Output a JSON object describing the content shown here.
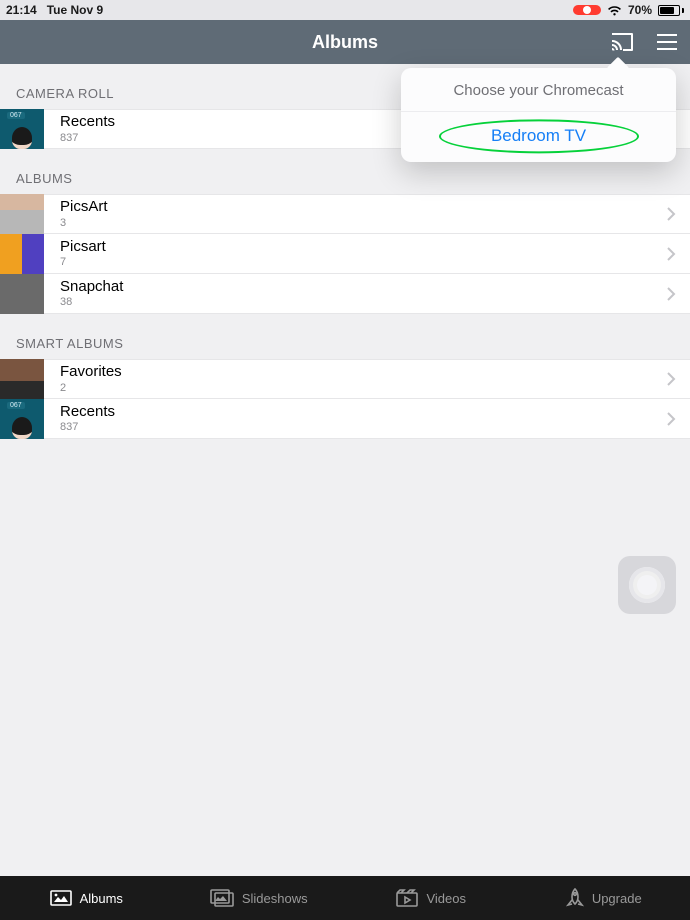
{
  "status": {
    "time": "21:14",
    "date": "Tue Nov 9",
    "battery_pct": "70%"
  },
  "header": {
    "title": "Albums"
  },
  "popover": {
    "title": "Choose your Chromecast",
    "items": [
      "Bedroom TV"
    ]
  },
  "sections": [
    {
      "title": "CAMERA ROLL",
      "rows": [
        {
          "title": "Recents",
          "count": "837"
        }
      ]
    },
    {
      "title": "ALBUMS",
      "rows": [
        {
          "title": "PicsArt",
          "count": "3"
        },
        {
          "title": "Picsart",
          "count": "7"
        },
        {
          "title": "Snapchat",
          "count": "38"
        }
      ]
    },
    {
      "title": "SMART ALBUMS",
      "rows": [
        {
          "title": "Favorites",
          "count": "2"
        },
        {
          "title": "Recents",
          "count": "837"
        }
      ]
    }
  ],
  "tabs": [
    {
      "label": "Albums"
    },
    {
      "label": "Slideshows"
    },
    {
      "label": "Videos"
    },
    {
      "label": "Upgrade"
    }
  ]
}
